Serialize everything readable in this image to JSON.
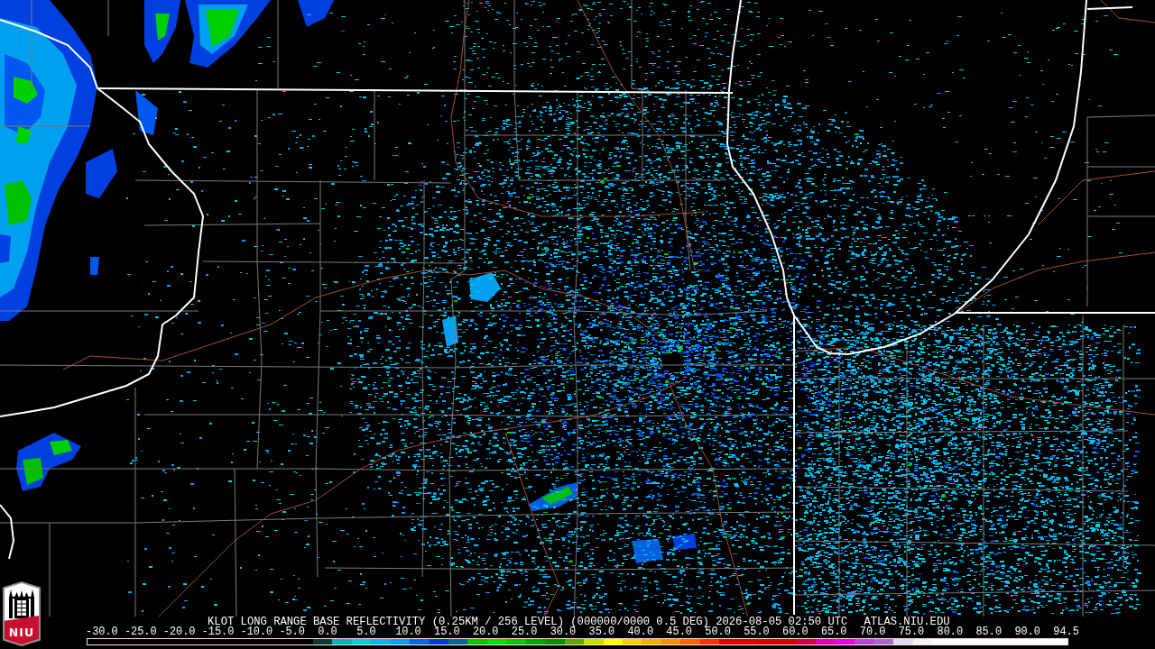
{
  "logo": {
    "text": "NIU"
  },
  "caption": {
    "title": "KLOT LONG RANGE BASE REFLECTIVITY (0.25KM / 256 LEVEL) (000000/0000 0.5 DEG) 2026-08-05 02:50 UTC",
    "source": "ATLAS.NIU.EDU"
  },
  "color_scale": {
    "labels": [
      "-30.0",
      "-25.0",
      "-20.0",
      "-15.0",
      "-10.0",
      "-5.0",
      "0.0",
      "5.0",
      "10.0",
      "15.0",
      "20.0",
      "25.0",
      "30.0",
      "35.0",
      "40.0",
      "45.0",
      "50.0",
      "55.0",
      "60.0",
      "65.0",
      "70.0",
      "75.0",
      "80.0",
      "85.0",
      "90.0",
      "94.5"
    ],
    "segments": [
      {
        "color": "#083838"
      },
      {
        "color": "#00b4bc"
      },
      {
        "color": "#00ccd8"
      },
      {
        "color": "#00b4f0"
      },
      {
        "color": "#00a0f0"
      },
      {
        "color": "#0068e4"
      },
      {
        "color": "#0038d4"
      },
      {
        "color": "#006890"
      },
      {
        "color": "#00c800"
      },
      {
        "color": "#00e000"
      },
      {
        "color": "#00c800"
      },
      {
        "color": "#00a800"
      },
      {
        "color": "#009000"
      },
      {
        "color": "#60a800"
      },
      {
        "color": "#c8dc00"
      },
      {
        "color": "#ffff00"
      },
      {
        "color": "#f0d000"
      },
      {
        "color": "#f0b000"
      },
      {
        "color": "#f09000"
      },
      {
        "color": "#ff6000"
      },
      {
        "color": "#ff3000"
      },
      {
        "color": "#e00000"
      },
      {
        "color": "#e00000"
      },
      {
        "color": "#d00000"
      },
      {
        "color": "#d00000"
      },
      {
        "color": "#d00040"
      },
      {
        "color": "#e000b0"
      },
      {
        "color": "#e800e8"
      },
      {
        "color": "#c040d8"
      },
      {
        "color": "#a868d0"
      },
      {
        "color": "#e0d8f0"
      },
      {
        "color": "#f8f0f8"
      },
      {
        "color": "#ffffff"
      },
      {
        "color": "#ffffff"
      },
      {
        "color": "#ffffff"
      },
      {
        "color": "#ffffff"
      },
      {
        "color": "#ffffff"
      },
      {
        "color": "#ffffff"
      },
      {
        "color": "#ffffff"
      }
    ]
  }
}
